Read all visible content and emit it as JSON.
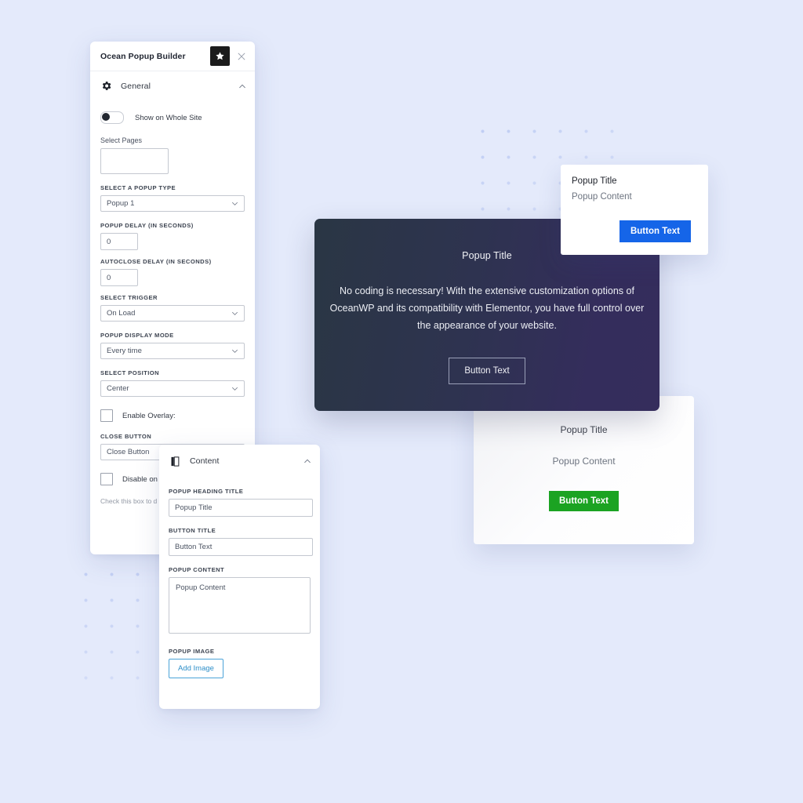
{
  "theme": {
    "background": "#e4eafb",
    "dot_color": "#b9c8f2",
    "accent_blue": "#1565e8",
    "accent_green": "#1ba322",
    "link_blue": "#2e8fc9",
    "dark_gradient_from": "#2a3644",
    "dark_gradient_to": "#352d5c"
  },
  "general_panel": {
    "title": "Ocean Popup Builder",
    "star_icon": "star-icon",
    "close_icon": "close-icon",
    "section": {
      "icon": "gear-icon",
      "label": "General",
      "collapse_icon": "chevron-up-icon"
    },
    "toggle": {
      "label": "Show on Whole Site",
      "state": "off"
    },
    "fields": {
      "select_pages_label": "Select Pages",
      "select_pages_value": "",
      "popup_type_label": "SELECT A POPUP TYPE",
      "popup_type_value": "Popup 1",
      "popup_delay_label": "POPUP DELAY (IN SECONDS)",
      "popup_delay_value": "0",
      "autoclose_delay_label": "AUTOCLOSE DELAY (IN SECONDS)",
      "autoclose_delay_value": "0",
      "select_trigger_label": "SELECT TRIGGER",
      "select_trigger_value": "On Load",
      "display_mode_label": "POPUP DISPLAY MODE",
      "display_mode_value": "Every time",
      "select_position_label": "SELECT POSITION",
      "select_position_value": "Center",
      "enable_overlay_label": "Enable Overlay:",
      "close_button_label": "CLOSE BUTTON",
      "close_button_value": "Close Button",
      "disable_on_mobile_label": "Disable on M",
      "disable_on_mobile_help": "Check this box to d devices."
    }
  },
  "content_panel": {
    "section": {
      "icon": "book-icon",
      "label": "Content",
      "collapse_icon": "chevron-up-icon"
    },
    "fields": {
      "heading_title_label": "POPUP HEADING TITLE",
      "heading_title_value": "Popup Title",
      "button_title_label": "BUTTON TITLE",
      "button_title_value": "Button Text",
      "popup_content_label": "POPUP CONTENT",
      "popup_content_value": "Popup Content",
      "popup_image_label": "POPUP IMAGE",
      "add_image_button": "Add Image"
    }
  },
  "previews": {
    "blue": {
      "title": "Popup Title",
      "content": "Popup Content",
      "button": "Button Text"
    },
    "dark": {
      "title": "Popup Title",
      "body": "No coding is necessary! With the extensive customization options of OceanWP and its compatibility with Elementor, you have full control over the appearance of your website.",
      "button": "Button Text"
    },
    "green": {
      "title": "Popup Title",
      "content": "Popup Content",
      "button": "Button Text"
    }
  }
}
